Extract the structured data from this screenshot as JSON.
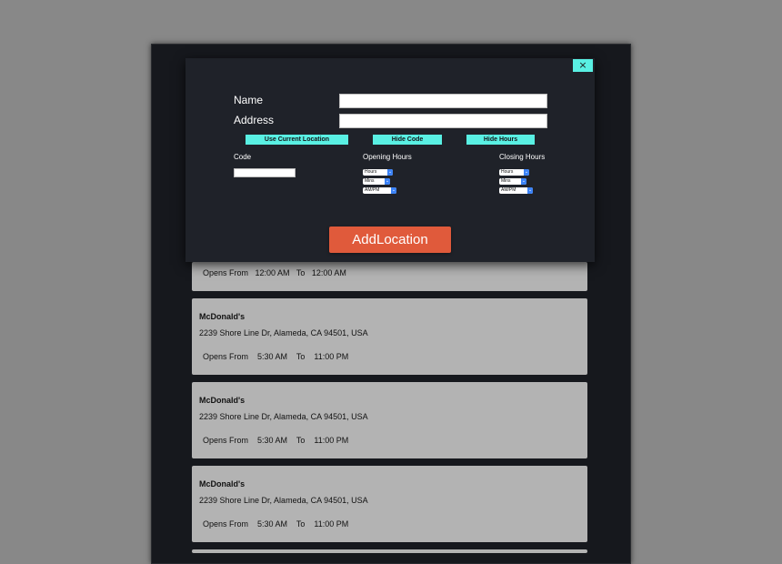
{
  "modal": {
    "close_label": "×",
    "name_label": "Name",
    "address_label": "Address",
    "name_value": "",
    "address_value": "",
    "use_location_label": "Use Current Location",
    "hide_code_label": "Hide Code",
    "hide_hours_label": "Hide Hours",
    "code_label": "Code",
    "code_value": "",
    "opening_label": "Opening Hours",
    "closing_label": "Closing Hours",
    "opening_selects": {
      "hours": "Hours",
      "mins": "Mins",
      "ampm": "AM/PM"
    },
    "closing_selects": {
      "hours": "Hours",
      "mins": "Mins",
      "ampm": "AM/PM"
    },
    "add_label": "AddLocation"
  },
  "locations": [
    {
      "name": "",
      "address": "",
      "hours": "Opens From   12:00 AM   To   12:00 AM"
    },
    {
      "name": "McDonald's",
      "address": "2239 Shore Line Dr, Alameda, CA 94501, USA",
      "hours": "Opens From    5:30 AM    To    11:00 PM"
    },
    {
      "name": "McDonald's",
      "address": "2239 Shore Line Dr, Alameda, CA 94501, USA",
      "hours": "Opens From    5:30 AM    To    11:00 PM"
    },
    {
      "name": "McDonald's",
      "address": "2239 Shore Line Dr, Alameda, CA 94501, USA",
      "hours": "Opens From    5:30 AM    To    11:00 PM"
    }
  ],
  "colors": {
    "backdrop": "#888888",
    "panel": "#16181d",
    "modal": "#1f2229",
    "card": "#b3b3b3",
    "accent_cyan": "#59f0e3",
    "primary_button": "#e05a3b"
  }
}
